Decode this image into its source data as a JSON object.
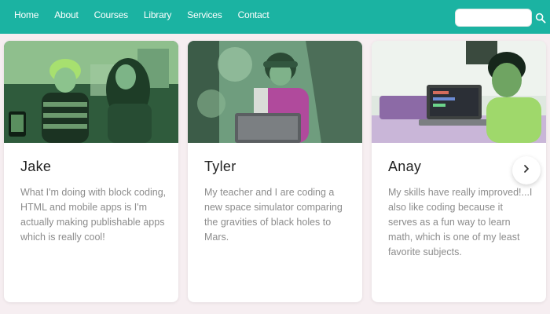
{
  "nav": {
    "items": [
      {
        "label": "Home"
      },
      {
        "label": "About"
      },
      {
        "label": "Courses"
      },
      {
        "label": "Library"
      },
      {
        "label": "Services"
      },
      {
        "label": "Contact"
      }
    ]
  },
  "search": {
    "value": "",
    "placeholder": "",
    "icon": "search-icon"
  },
  "cards": [
    {
      "name": "Jake",
      "text": "What I'm doing with block coding, HTML and mobile apps is I'm actually making publishable apps which is really cool!",
      "photo": "photo of boy and woman with tablet"
    },
    {
      "name": "Tyler",
      "text": "My teacher and I are coding a new space simulator comparing the gravities of black holes to Mars.",
      "photo": "photo of boy with headphones and laptop outdoors"
    },
    {
      "name": "Anay",
      "text": "My skills have really improved!...I also like coding because it serves as a fun way to learn math, which is one of my least favorite subjects.",
      "photo": "photo of boy smiling at laptop"
    }
  ],
  "carousel": {
    "next_icon": "chevron-right-icon"
  },
  "colors": {
    "nav_bg": "#1bb3a2",
    "page_bg": "#f6eef1",
    "card_bg": "#ffffff",
    "body_text": "#8c8c8c",
    "name_text": "#222222"
  }
}
